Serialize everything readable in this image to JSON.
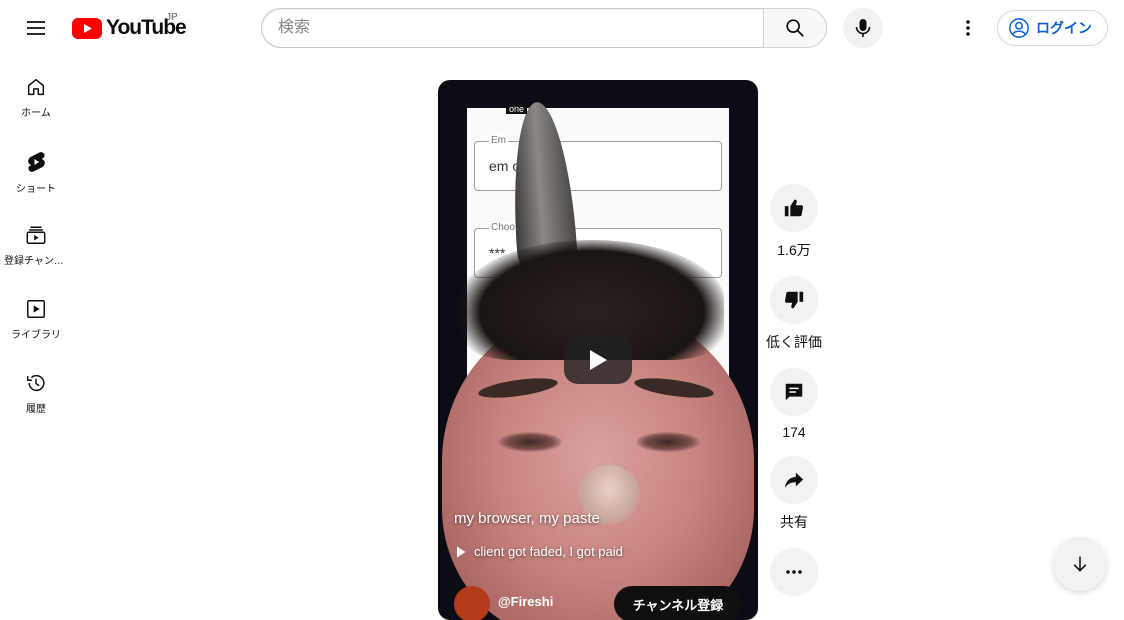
{
  "header": {
    "logo_text": "YouTube",
    "region": "JP",
    "search_placeholder": "検索",
    "login_label": "ログイン"
  },
  "sidebar": {
    "items": [
      {
        "label": "ホーム",
        "icon": "home-icon"
      },
      {
        "label": "ショート",
        "icon": "shorts-icon"
      },
      {
        "label": "登録チャンネル",
        "icon": "subscriptions-icon"
      },
      {
        "label": "ライブラリ",
        "icon": "library-icon"
      },
      {
        "label": "履歴",
        "icon": "history-icon"
      }
    ]
  },
  "video": {
    "form_email_label": "Em",
    "form_email_value": "em            com",
    "form_password_label": "Choo",
    "form_password_value": "***",
    "overlay_tag": "one",
    "title": "my browser, my paste",
    "music": "client got faded, I got paid",
    "channel_name": "@Fireshi",
    "subscribe_label": "チャンネル登録"
  },
  "actions": {
    "like_count": "1.6万",
    "dislike_label": "低く評価",
    "comment_count": "174",
    "share_label": "共有"
  },
  "colors": {
    "brand_red": "#ff0000",
    "link_blue": "#065fd4",
    "button_bg": "#f2f2f2"
  }
}
